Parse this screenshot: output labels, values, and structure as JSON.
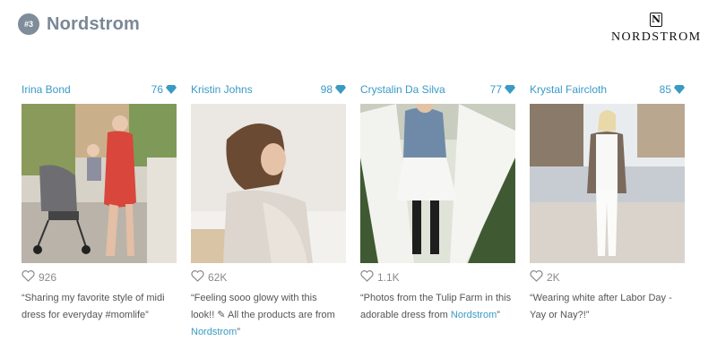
{
  "header": {
    "rank": "#3",
    "title": "Nordstrom"
  },
  "logo": {
    "mark": "N",
    "text": "NORDSTROM"
  },
  "colors": {
    "accent": "#3a9ac6",
    "title": "#7a8896",
    "badge": "#7f8c9a"
  },
  "cards": [
    {
      "author": "Irina Bond",
      "score": "76",
      "likes": "926",
      "caption": "“Sharing my favorite style of midi dress for everyday #momlife”",
      "caption_link": "",
      "caption_end": ""
    },
    {
      "author": "Kristin Johns",
      "score": "98",
      "likes": "62K",
      "caption": "“Feeling sooo glowy with this look!! ✎ All the products are from ",
      "caption_link": "Nordstrom",
      "caption_end": "”"
    },
    {
      "author": "Crystalin Da Silva",
      "score": "77",
      "likes": "1.1K",
      "caption": "“Photos from the Tulip Farm in this adorable dress from ",
      "caption_link": "Nordstrom",
      "caption_end": "”"
    },
    {
      "author": "Krystal Faircloth",
      "score": "85",
      "likes": "2K",
      "caption": "“Wearing white after Labor Day - Yay or Nay?!”",
      "caption_link": "",
      "caption_end": ""
    }
  ],
  "icons": {
    "score": "diamond-icon",
    "likes": "heart-icon",
    "logo": "n-monogram-icon"
  }
}
